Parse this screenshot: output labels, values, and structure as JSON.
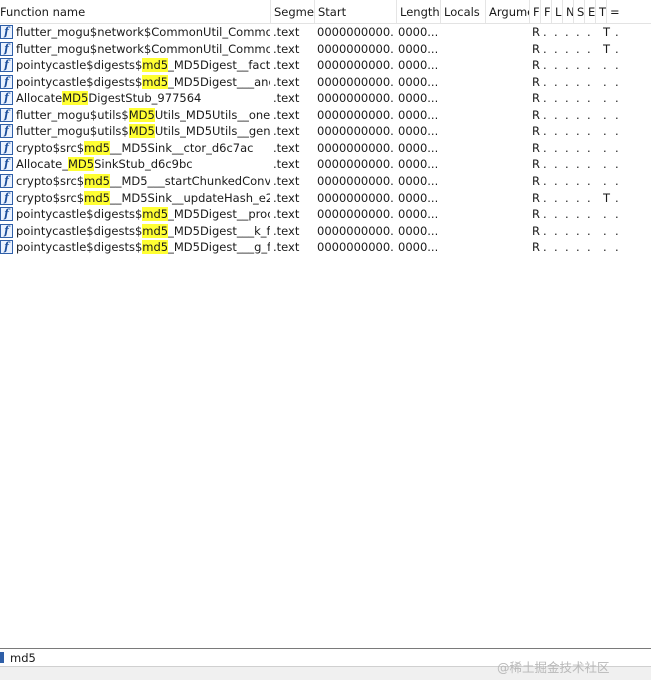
{
  "columns": {
    "function_name": "Function name",
    "segment": "Segme",
    "start": "Start",
    "length": "Length",
    "locals": "Locals",
    "arguments": "Argume",
    "f1": "F",
    "f2": "F",
    "f3": "L",
    "f4": "N",
    "f5": "S",
    "f6": "E",
    "f7": "T",
    "f8": "="
  },
  "icons": {
    "function": "function-icon",
    "function_glyph": "f"
  },
  "rows": [
    {
      "name": [
        "flutter_mogu$network$CommonUtil_Common..."
      ],
      "hl": [
        false
      ],
      "segment": ".text",
      "start": "0000000000...",
      "length": "0000...",
      "flags": [
        "R",
        ".",
        ".",
        ".",
        ".",
        ".",
        "T",
        "."
      ]
    },
    {
      "name": [
        "flutter_mogu$network$CommonUtil_Common..."
      ],
      "hl": [
        false
      ],
      "segment": ".text",
      "start": "0000000000...",
      "length": "0000...",
      "flags": [
        "R",
        ".",
        ".",
        ".",
        ".",
        ".",
        "T",
        "."
      ]
    },
    {
      "name": [
        "pointycastle$digests$",
        "md5",
        "_MD5Digest__facto..."
      ],
      "hl": [
        false,
        true,
        false
      ],
      "segment": ".text",
      "start": "0000000000...",
      "length": "0000...",
      "flags": [
        "R",
        ".",
        ".",
        ".",
        ".",
        ".",
        ".",
        "."
      ]
    },
    {
      "name": [
        "pointycastle$digests$",
        "md5",
        "_MD5Digest___ano..."
      ],
      "hl": [
        false,
        true,
        false
      ],
      "segment": ".text",
      "start": "0000000000...",
      "length": "0000...",
      "flags": [
        "R",
        ".",
        ".",
        ".",
        ".",
        ".",
        ".",
        "."
      ]
    },
    {
      "name": [
        "Allocate",
        "MD5",
        "DigestStub_977564"
      ],
      "hl": [
        false,
        true,
        false
      ],
      "segment": ".text",
      "start": "0000000000...",
      "length": "0000...",
      "flags": [
        "R",
        ".",
        ".",
        ".",
        ".",
        ".",
        ".",
        "."
      ]
    },
    {
      "name": [
        "flutter_mogu$utils$",
        "MD5",
        "Utils_MD5Utils__oneL..."
      ],
      "hl": [
        false,
        true,
        false
      ],
      "segment": ".text",
      "start": "0000000000...",
      "length": "0000...",
      "flags": [
        "R",
        ".",
        ".",
        ".",
        ".",
        ".",
        ".",
        "."
      ]
    },
    {
      "name": [
        "flutter_mogu$utils$",
        "MD5",
        "Utils_MD5Utils__gene..."
      ],
      "hl": [
        false,
        true,
        false
      ],
      "segment": ".text",
      "start": "0000000000...",
      "length": "0000...",
      "flags": [
        "R",
        ".",
        ".",
        ".",
        ".",
        ".",
        ".",
        "."
      ]
    },
    {
      "name": [
        "crypto$src$",
        "md5",
        "__MD5Sink__ctor_d6c7ac"
      ],
      "hl": [
        false,
        true,
        false
      ],
      "segment": ".text",
      "start": "0000000000...",
      "length": "0000...",
      "flags": [
        "R",
        ".",
        ".",
        ".",
        ".",
        ".",
        ".",
        "."
      ]
    },
    {
      "name": [
        "Allocate_",
        "MD5",
        "SinkStub_d6c9bc"
      ],
      "hl": [
        false,
        true,
        false
      ],
      "segment": ".text",
      "start": "0000000000...",
      "length": "0000...",
      "flags": [
        "R",
        ".",
        ".",
        ".",
        ".",
        ".",
        ".",
        "."
      ]
    },
    {
      "name": [
        "crypto$src$",
        "md5",
        "__MD5___startChunkedConver..."
      ],
      "hl": [
        false,
        true,
        false
      ],
      "segment": ".text",
      "start": "0000000000...",
      "length": "0000...",
      "flags": [
        "R",
        ".",
        ".",
        ".",
        ".",
        ".",
        ".",
        "."
      ]
    },
    {
      "name": [
        "crypto$src$",
        "md5",
        "__MD5Sink__updateHash_e2..."
      ],
      "hl": [
        false,
        true,
        false
      ],
      "segment": ".text",
      "start": "0000000000...",
      "length": "0000...",
      "flags": [
        "R",
        ".",
        ".",
        ".",
        ".",
        ".",
        "T",
        "."
      ]
    },
    {
      "name": [
        "pointycastle$digests$",
        "md5",
        "_MD5Digest__proce..."
      ],
      "hl": [
        false,
        true,
        false
      ],
      "segment": ".text",
      "start": "0000000000...",
      "length": "0000...",
      "flags": [
        "R",
        ".",
        ".",
        ".",
        ".",
        ".",
        ".",
        "."
      ]
    },
    {
      "name": [
        "pointycastle$digests$",
        "md5",
        "_MD5Digest___k_f1..."
      ],
      "hl": [
        false,
        true,
        false
      ],
      "segment": ".text",
      "start": "0000000000...",
      "length": "0000...",
      "flags": [
        "R",
        ".",
        ".",
        ".",
        ".",
        ".",
        ".",
        "."
      ]
    },
    {
      "name": [
        "pointycastle$digests$",
        "md5",
        "_MD5Digest___g_f1..."
      ],
      "hl": [
        false,
        true,
        false
      ],
      "segment": ".text",
      "start": "0000000000...",
      "length": "0000...",
      "flags": [
        "R",
        ".",
        ".",
        ".",
        ".",
        ".",
        ".",
        "."
      ]
    }
  ],
  "filter": {
    "value": "md5"
  },
  "watermark": "@稀土掘金技术社区",
  "colors": {
    "highlight": "#ffff33",
    "icon_border": "#2f5fa8"
  }
}
